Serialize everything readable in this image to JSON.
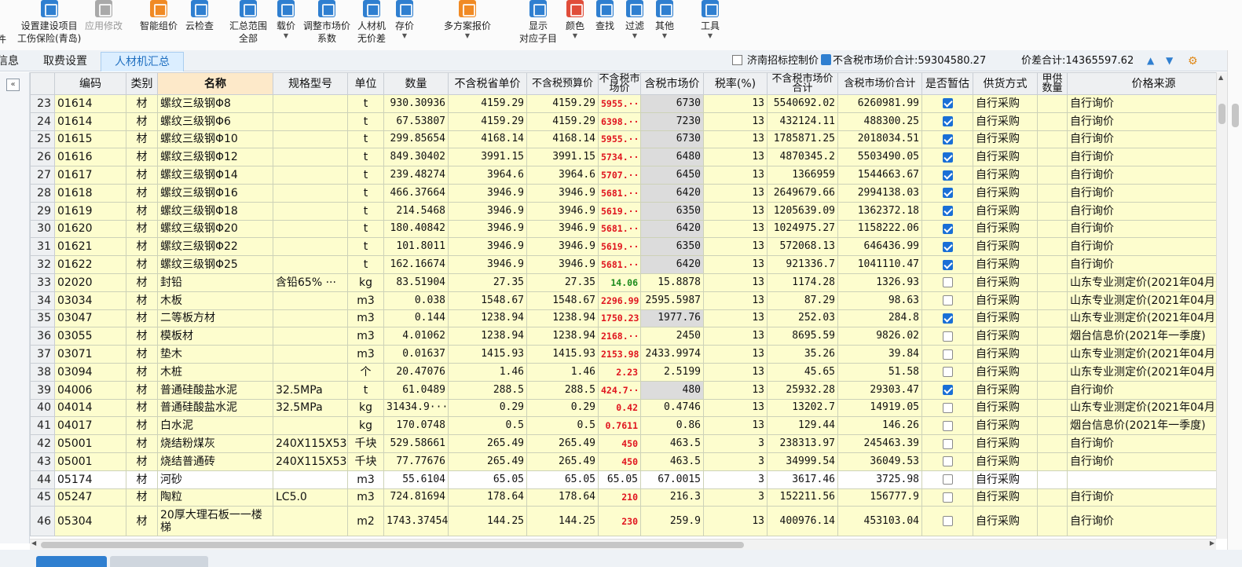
{
  "toolbar": {
    "left_cut": "件",
    "set_project_line1": "设置建设项目",
    "set_project_line2": "工伤保险(青岛)",
    "apply_modify": "应用修改",
    "smart_price": "智能组价",
    "cloud_check": "云检查",
    "summary_range_line1": "汇总范围",
    "summary_range_line2": "全部",
    "load_price": "载价",
    "adjust_market_line1": "调整市场价",
    "adjust_market_line2": "系数",
    "labor_machine_line1": "人材机",
    "labor_machine_line2": "无价差",
    "store_price": "存价",
    "multi_quote": "多方案报价",
    "show_line1": "显示",
    "show_line2": "对应子目",
    "color": "颜色",
    "find": "查找",
    "filter": "过滤",
    "other": "其他",
    "tools": "工具"
  },
  "tabs": {
    "left_cut": "信息",
    "fee_settings": "取费设置",
    "labor_summary": "人材机汇总"
  },
  "controls": {
    "jinan_control": "济南招标控制价",
    "market_total_label": "不含税市场价合计:59304580.27",
    "price_diff_label": "价差合计:14365597.62"
  },
  "columns": [
    "编码",
    "类别",
    "名称",
    "规格型号",
    "单位",
    "数量",
    "不含税省单价",
    "不含税预算价",
    "不含税市场价",
    "含税市场价",
    "税率(%)",
    "不含税市场价合计",
    "含税市场价合计",
    "是否暂估",
    "供货方式",
    "甲供数量",
    "价格来源"
  ],
  "rows": [
    {
      "n": "23",
      "code": "01614",
      "cat": "材",
      "name": "螺纹三级钢Φ8",
      "spec": "",
      "unit": "t",
      "qty": "930.30936",
      "prov": "4159.29",
      "budget": "4159.29",
      "mkt": "5955.···",
      "mktc": "red",
      "tax_mkt": "6730",
      "tax_gray": true,
      "rate": "13",
      "sum": "5540692.02",
      "sum_tax": "6260981.99",
      "est": true,
      "supply": "自行采购",
      "src": "自行询价"
    },
    {
      "n": "24",
      "code": "01614",
      "cat": "材",
      "name": "螺纹三级钢Φ6",
      "spec": "",
      "unit": "t",
      "qty": "67.53807",
      "prov": "4159.29",
      "budget": "4159.29",
      "mkt": "6398.···",
      "mktc": "red",
      "tax_mkt": "7230",
      "tax_gray": true,
      "rate": "13",
      "sum": "432124.11",
      "sum_tax": "488300.25",
      "est": true,
      "supply": "自行采购",
      "src": "自行询价"
    },
    {
      "n": "25",
      "code": "01615",
      "cat": "材",
      "name": "螺纹三级钢Φ10",
      "spec": "",
      "unit": "t",
      "qty": "299.85654",
      "prov": "4168.14",
      "budget": "4168.14",
      "mkt": "5955.···",
      "mktc": "red",
      "tax_mkt": "6730",
      "tax_gray": true,
      "rate": "13",
      "sum": "1785871.25",
      "sum_tax": "2018034.51",
      "est": true,
      "supply": "自行采购",
      "src": "自行询价"
    },
    {
      "n": "26",
      "code": "01616",
      "cat": "材",
      "name": "螺纹三级钢Φ12",
      "spec": "",
      "unit": "t",
      "qty": "849.30402",
      "prov": "3991.15",
      "budget": "3991.15",
      "mkt": "5734.···",
      "mktc": "red",
      "tax_mkt": "6480",
      "tax_gray": true,
      "rate": "13",
      "sum": "4870345.2",
      "sum_tax": "5503490.05",
      "est": true,
      "supply": "自行采购",
      "src": "自行询价"
    },
    {
      "n": "27",
      "code": "01617",
      "cat": "材",
      "name": "螺纹三级钢Φ14",
      "spec": "",
      "unit": "t",
      "qty": "239.48274",
      "prov": "3964.6",
      "budget": "3964.6",
      "mkt": "5707.···",
      "mktc": "red",
      "tax_mkt": "6450",
      "tax_gray": true,
      "rate": "13",
      "sum": "1366959",
      "sum_tax": "1544663.67",
      "est": true,
      "supply": "自行采购",
      "src": "自行询价"
    },
    {
      "n": "28",
      "code": "01618",
      "cat": "材",
      "name": "螺纹三级钢Φ16",
      "spec": "",
      "unit": "t",
      "qty": "466.37664",
      "prov": "3946.9",
      "budget": "3946.9",
      "mkt": "5681.···",
      "mktc": "red",
      "tax_mkt": "6420",
      "tax_gray": true,
      "rate": "13",
      "sum": "2649679.66",
      "sum_tax": "2994138.03",
      "est": true,
      "supply": "自行采购",
      "src": "自行询价"
    },
    {
      "n": "29",
      "code": "01619",
      "cat": "材",
      "name": "螺纹三级钢Φ18",
      "spec": "",
      "unit": "t",
      "qty": "214.5468",
      "prov": "3946.9",
      "budget": "3946.9",
      "mkt": "5619.···",
      "mktc": "red",
      "tax_mkt": "6350",
      "tax_gray": true,
      "rate": "13",
      "sum": "1205639.09",
      "sum_tax": "1362372.18",
      "est": true,
      "supply": "自行采购",
      "src": "自行询价"
    },
    {
      "n": "30",
      "code": "01620",
      "cat": "材",
      "name": "螺纹三级钢Φ20",
      "spec": "",
      "unit": "t",
      "qty": "180.40842",
      "prov": "3946.9",
      "budget": "3946.9",
      "mkt": "5681.···",
      "mktc": "red",
      "tax_mkt": "6420",
      "tax_gray": true,
      "rate": "13",
      "sum": "1024975.27",
      "sum_tax": "1158222.06",
      "est": true,
      "supply": "自行采购",
      "src": "自行询价"
    },
    {
      "n": "31",
      "code": "01621",
      "cat": "材",
      "name": "螺纹三级钢Φ22",
      "spec": "",
      "unit": "t",
      "qty": "101.8011",
      "prov": "3946.9",
      "budget": "3946.9",
      "mkt": "5619.···",
      "mktc": "red",
      "tax_mkt": "6350",
      "tax_gray": true,
      "rate": "13",
      "sum": "572068.13",
      "sum_tax": "646436.99",
      "est": true,
      "supply": "自行采购",
      "src": "自行询价"
    },
    {
      "n": "32",
      "code": "01622",
      "cat": "材",
      "name": "螺纹三级钢Φ25",
      "spec": "",
      "unit": "t",
      "qty": "162.16674",
      "prov": "3946.9",
      "budget": "3946.9",
      "mkt": "5681.···",
      "mktc": "red",
      "tax_mkt": "6420",
      "tax_gray": true,
      "rate": "13",
      "sum": "921336.7",
      "sum_tax": "1041110.47",
      "est": true,
      "supply": "自行采购",
      "src": "自行询价"
    },
    {
      "n": "33",
      "code": "02020",
      "cat": "材",
      "name": "封铅",
      "spec": "含铅65% ···",
      "unit": "kg",
      "qty": "83.51904",
      "prov": "27.35",
      "budget": "27.35",
      "mkt": "14.06",
      "mktc": "green",
      "tax_mkt": "15.8878",
      "tax_gray": false,
      "rate": "13",
      "sum": "1174.28",
      "sum_tax": "1326.93",
      "est": false,
      "supply": "自行采购",
      "src": "山东专业测定价(2021年04月"
    },
    {
      "n": "34",
      "code": "03034",
      "cat": "材",
      "name": "木板",
      "spec": "",
      "unit": "m3",
      "qty": "0.038",
      "prov": "1548.67",
      "budget": "1548.67",
      "mkt": "2296.99",
      "mktc": "red",
      "tax_mkt": "2595.5987",
      "tax_gray": false,
      "rate": "13",
      "sum": "87.29",
      "sum_tax": "98.63",
      "est": false,
      "supply": "自行采购",
      "src": "山东专业测定价(2021年04月"
    },
    {
      "n": "35",
      "code": "03047",
      "cat": "材",
      "name": "二等板方材",
      "spec": "",
      "unit": "m3",
      "qty": "0.144",
      "prov": "1238.94",
      "budget": "1238.94",
      "mkt": "1750.23",
      "mktc": "red",
      "tax_mkt": "1977.76",
      "tax_gray": true,
      "rate": "13",
      "sum": "252.03",
      "sum_tax": "284.8",
      "est": true,
      "supply": "自行采购",
      "src": "山东专业测定价(2021年04月"
    },
    {
      "n": "36",
      "code": "03055",
      "cat": "材",
      "name": "模板材",
      "spec": "",
      "unit": "m3",
      "qty": "4.01062",
      "prov": "1238.94",
      "budget": "1238.94",
      "mkt": "2168.···",
      "mktc": "red",
      "tax_mkt": "2450",
      "tax_gray": false,
      "rate": "13",
      "sum": "8695.59",
      "sum_tax": "9826.02",
      "est": false,
      "supply": "自行采购",
      "src": "烟台信息价(2021年一季度)"
    },
    {
      "n": "37",
      "code": "03071",
      "cat": "材",
      "name": "垫木",
      "spec": "",
      "unit": "m3",
      "qty": "0.01637",
      "prov": "1415.93",
      "budget": "1415.93",
      "mkt": "2153.98",
      "mktc": "red",
      "tax_mkt": "2433.9974",
      "tax_gray": false,
      "rate": "13",
      "sum": "35.26",
      "sum_tax": "39.84",
      "est": false,
      "supply": "自行采购",
      "src": "山东专业测定价(2021年04月"
    },
    {
      "n": "38",
      "code": "03094",
      "cat": "材",
      "name": "木桩",
      "spec": "",
      "unit": "个",
      "qty": "20.47076",
      "prov": "1.46",
      "budget": "1.46",
      "mkt": "2.23",
      "mktc": "red",
      "tax_mkt": "2.5199",
      "tax_gray": false,
      "rate": "13",
      "sum": "45.65",
      "sum_tax": "51.58",
      "est": false,
      "supply": "自行采购",
      "src": "山东专业测定价(2021年04月"
    },
    {
      "n": "39",
      "code": "04006",
      "cat": "材",
      "name": "普通硅酸盐水泥",
      "spec": "32.5MPa",
      "unit": "t",
      "qty": "61.0489",
      "prov": "288.5",
      "budget": "288.5",
      "mkt": "424.7···",
      "mktc": "red",
      "tax_mkt": "480",
      "tax_gray": true,
      "rate": "13",
      "sum": "25932.28",
      "sum_tax": "29303.47",
      "est": true,
      "supply": "自行采购",
      "src": "自行询价"
    },
    {
      "n": "40",
      "code": "04014",
      "cat": "材",
      "name": "普通硅酸盐水泥",
      "spec": "32.5MPa",
      "unit": "kg",
      "qty": "31434.9···",
      "prov": "0.29",
      "budget": "0.29",
      "mkt": "0.42",
      "mktc": "red",
      "tax_mkt": "0.4746",
      "tax_gray": false,
      "rate": "13",
      "sum": "13202.7",
      "sum_tax": "14919.05",
      "est": false,
      "supply": "自行采购",
      "src": "山东专业测定价(2021年04月"
    },
    {
      "n": "41",
      "code": "04017",
      "cat": "材",
      "name": "白水泥",
      "spec": "",
      "unit": "kg",
      "qty": "170.0748",
      "prov": "0.5",
      "budget": "0.5",
      "mkt": "0.7611",
      "mktc": "red",
      "tax_mkt": "0.86",
      "tax_gray": false,
      "rate": "13",
      "sum": "129.44",
      "sum_tax": "146.26",
      "est": false,
      "supply": "自行采购",
      "src": "烟台信息价(2021年一季度)"
    },
    {
      "n": "42",
      "code": "05001",
      "cat": "材",
      "name": "烧结粉煤灰",
      "spec": "240X115X53",
      "unit": "千块",
      "qty": "529.58661",
      "prov": "265.49",
      "budget": "265.49",
      "mkt": "450",
      "mktc": "red",
      "tax_mkt": "463.5",
      "tax_gray": false,
      "rate": "3",
      "sum": "238313.97",
      "sum_tax": "245463.39",
      "est": false,
      "supply": "自行采购",
      "src": "自行询价"
    },
    {
      "n": "43",
      "code": "05001",
      "cat": "材",
      "name": "烧结普通砖",
      "spec": "240X115X53",
      "unit": "千块",
      "qty": "77.77676",
      "prov": "265.49",
      "budget": "265.49",
      "mkt": "450",
      "mktc": "red",
      "tax_mkt": "463.5",
      "tax_gray": false,
      "rate": "3",
      "sum": "34999.54",
      "sum_tax": "36049.53",
      "est": false,
      "supply": "自行采购",
      "src": "自行询价"
    },
    {
      "n": "44",
      "code": "05174",
      "cat": "材",
      "name": "河砂",
      "spec": "",
      "unit": "m3",
      "qty": "55.6104",
      "prov": "65.05",
      "budget": "65.05",
      "mkt": "65.05",
      "mktc": "plain",
      "tax_mkt": "67.0015",
      "tax_gray": false,
      "rate": "3",
      "sum": "3617.46",
      "sum_tax": "3725.98",
      "est": false,
      "supply": "自行采购",
      "src": "",
      "white": true
    },
    {
      "n": "45",
      "code": "05247",
      "cat": "材",
      "name": "陶粒",
      "spec": "LC5.0",
      "unit": "m3",
      "qty": "724.81694",
      "prov": "178.64",
      "budget": "178.64",
      "mkt": "210",
      "mktc": "red",
      "tax_mkt": "216.3",
      "tax_gray": false,
      "rate": "3",
      "sum": "152211.56",
      "sum_tax": "156777.9",
      "est": false,
      "supply": "自行采购",
      "src": "自行询价"
    },
    {
      "n": "46",
      "code": "05304",
      "cat": "材",
      "name": "20厚大理石板一一楼梯",
      "spec": "",
      "unit": "m2",
      "qty": "1743.37454",
      "prov": "144.25",
      "budget": "144.25",
      "mkt": "230",
      "mktc": "red",
      "tax_mkt": "259.9",
      "tax_gray": false,
      "rate": "13",
      "sum": "400976.14",
      "sum_tax": "453103.04",
      "est": false,
      "supply": "自行采购",
      "src": "自行询价",
      "tall": true
    }
  ]
}
